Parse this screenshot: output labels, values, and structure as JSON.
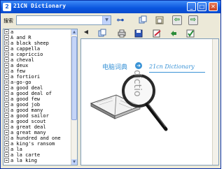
{
  "window": {
    "app_icon_text": "2",
    "title": "21CN Dictionary",
    "min_glyph": "_",
    "max_glyph": "□",
    "close_glyph": "✕"
  },
  "search": {
    "label": "搜索",
    "value": "",
    "dropdown_glyph": "▼"
  },
  "toolbar": {
    "search_go_glyph": "⊶",
    "back_glyph": "⇦",
    "forward_glyph": "⇨",
    "nav_left_glyph": "◀"
  },
  "word_list": [
    "a",
    "A and R",
    "a black sheep",
    "a cappella",
    "a capriccio",
    "a cheval",
    "a deux",
    "a few",
    "a fortiori",
    "a-go-go",
    "a good deal",
    "a good deal of",
    "a good few",
    "a good job",
    "a good many",
    "a good sailor",
    "a good scout",
    "a great deal",
    "a great many",
    "a hundred and one",
    "a king's ransom",
    "a la",
    "a la carte",
    "a la king"
  ],
  "logo": {
    "cn": "电脑词典",
    "arrow_glyph": "➜",
    "en": "21cn Dictionary",
    "vertical": "dictio"
  },
  "colors": {
    "titlebar": "#0a55de",
    "frame": "#ece9d8",
    "logo_blue": "#3a93d6"
  },
  "icons": [
    "search-go-icon",
    "back-icon",
    "forward-icon",
    "copy-icon",
    "paste-icon",
    "print-icon",
    "save-icon",
    "edit-icon",
    "help-icon",
    "close-icon",
    "undo-icon",
    "check-icon"
  ]
}
